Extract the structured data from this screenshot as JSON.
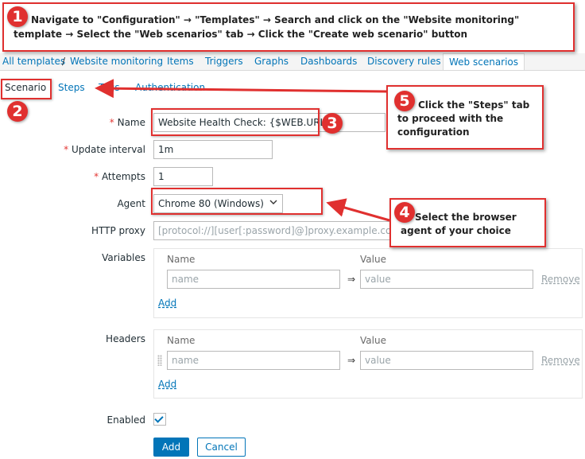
{
  "breadcrumbs": [
    {
      "label": "All templates"
    },
    {
      "label": "Website monitoring"
    },
    {
      "label": "Items"
    },
    {
      "label": "Triggers"
    },
    {
      "label": "Graphs"
    },
    {
      "label": "Dashboards"
    },
    {
      "label": "Discovery rules"
    },
    {
      "label": "Web scenarios"
    }
  ],
  "crumb_separator": "/",
  "subtabs": [
    {
      "label": "Scenario"
    },
    {
      "label": "Steps"
    },
    {
      "label": "Tags"
    },
    {
      "label": "Authentication"
    }
  ],
  "form": {
    "required_mark": "*",
    "name_label": "Name",
    "name_value": "Website Health Check: {$WEB.URL}",
    "update_interval_label": "Update interval",
    "update_interval_value": "1m",
    "attempts_label": "Attempts",
    "attempts_value": "1",
    "agent_label": "Agent",
    "agent_value": "Chrome 80 (Windows)",
    "http_proxy_label": "HTTP proxy",
    "http_proxy_placeholder": "[protocol://][user[:password]@]proxy.example.com[:port]",
    "variables_label": "Variables",
    "headers_label": "Headers",
    "col_name": "Name",
    "col_value": "Value",
    "name_placeholder": "name",
    "value_placeholder": "value",
    "pair_arrow": "⇒",
    "remove_label": "Remove",
    "add_label": "Add",
    "enabled_label": "Enabled",
    "enabled_checked": true,
    "add_button": "Add",
    "cancel_button": "Cancel"
  },
  "annotations": {
    "step1_number": "1",
    "step1_text": "Navigate to \"Configuration\" → \"Templates\" → Search and click on the \"Website monitoring\" template → Select the \"Web scenarios\" tab → Click the \"Create web scenario\" button",
    "step2_number": "2",
    "step3_number": "3",
    "step4_number": "4",
    "step4_text": "Select the browser agent of your choice",
    "step5_number": "5",
    "step5_text": "Click the \"Steps\" tab to proceed with the configuration",
    "accent_color": "#e0302f"
  },
  "colors": {
    "link": "#0275b8",
    "required": "#e33734",
    "breadcrumb_bg": "#f4f4f4"
  }
}
